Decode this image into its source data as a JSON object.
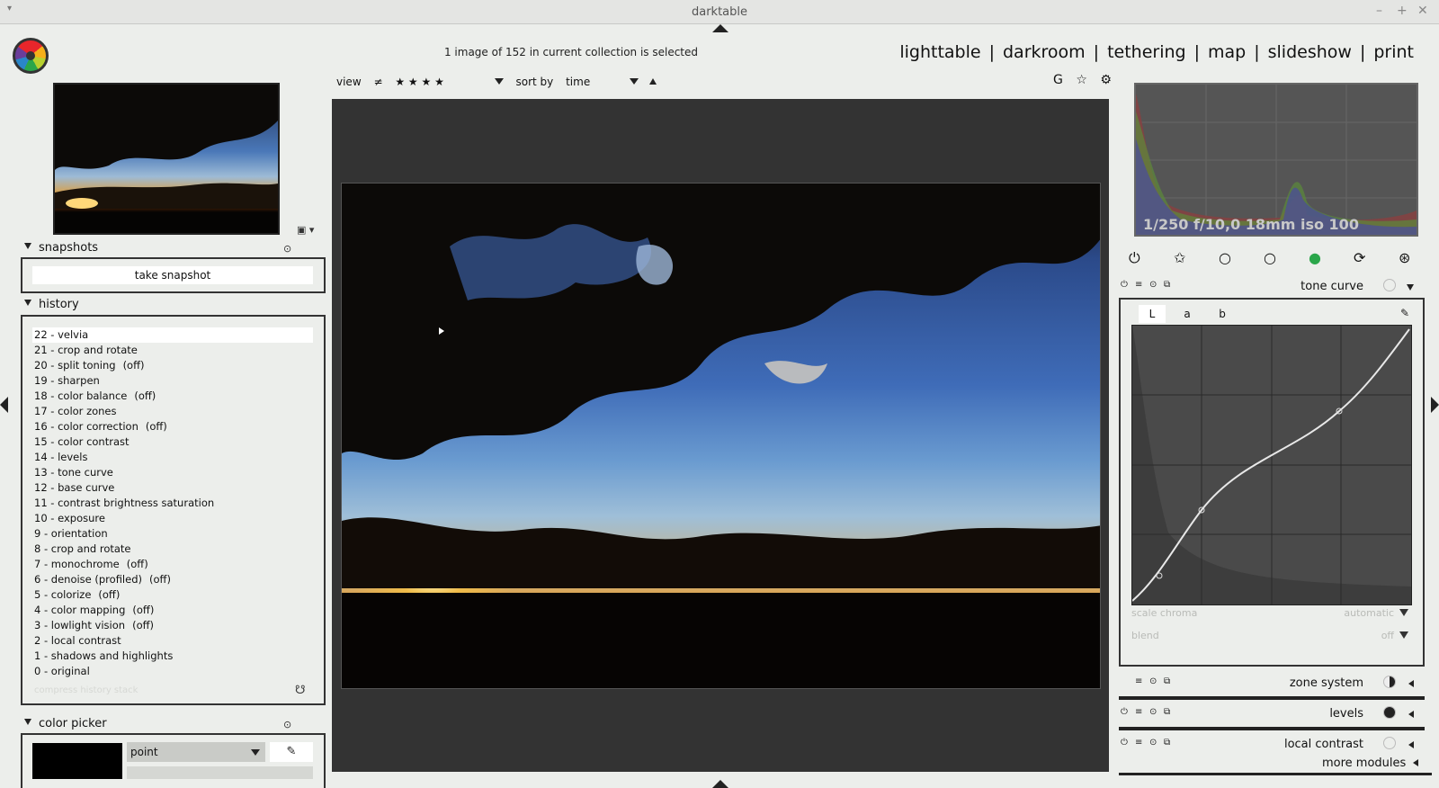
{
  "window": {
    "title": "darktable",
    "menu_glyph": "▾",
    "minimize": "–",
    "maximize": "+",
    "close": "✕"
  },
  "header": {
    "status": "1 image of 152 in current collection is selected",
    "views": [
      "lighttable",
      "darkroom",
      "tethering",
      "map",
      "slideshow",
      "print"
    ],
    "separator": "|"
  },
  "filterbar": {
    "view_label": "view",
    "rating_op": "≠",
    "stars": "★ ★ ★ ★",
    "sort_label": "sort by",
    "sort_value": "time",
    "icons": {
      "grouping": "G",
      "overlays": "☆",
      "preferences": "⚙"
    }
  },
  "left": {
    "thumb_ctl": "▣ ▾",
    "snapshots": {
      "title": "snapshots",
      "button": "take snapshot",
      "header_icon": "⊙"
    },
    "history": {
      "title": "history",
      "items": [
        {
          "label": "22 - velvia",
          "state": "",
          "selected": true
        },
        {
          "label": "21 - crop and rotate",
          "state": ""
        },
        {
          "label": "20 - split toning",
          "state": "(off)"
        },
        {
          "label": "19 - sharpen",
          "state": ""
        },
        {
          "label": "18 - color balance",
          "state": "(off)"
        },
        {
          "label": "17 - color zones",
          "state": ""
        },
        {
          "label": "16 - color correction",
          "state": "(off)"
        },
        {
          "label": "15 - color contrast",
          "state": ""
        },
        {
          "label": "14 - levels",
          "state": ""
        },
        {
          "label": "13 - tone curve",
          "state": ""
        },
        {
          "label": "12 - base curve",
          "state": ""
        },
        {
          "label": "11 - contrast brightness saturation",
          "state": ""
        },
        {
          "label": "10 - exposure",
          "state": ""
        },
        {
          "label": "9 - orientation",
          "state": ""
        },
        {
          "label": "8 - crop and rotate",
          "state": ""
        },
        {
          "label": "7 - monochrome",
          "state": "(off)"
        },
        {
          "label": "6 - denoise (profiled)",
          "state": "(off)"
        },
        {
          "label": "5 - colorize",
          "state": "(off)"
        },
        {
          "label": "4 - color mapping",
          "state": "(off)"
        },
        {
          "label": "3 - lowlight vision",
          "state": "(off)"
        },
        {
          "label": "2 - local contrast",
          "state": ""
        },
        {
          "label": "1 - shadows and highlights",
          "state": ""
        },
        {
          "label": "0 - original",
          "state": ""
        }
      ],
      "compress": "compress history stack",
      "style_icon": "☋"
    },
    "color_picker": {
      "title": "color picker",
      "mode": "point",
      "picker_icon": "✎",
      "header_icon": "⊙"
    }
  },
  "right": {
    "histogram_info": "1/250 f/10,0 18mm iso 100",
    "group_tabs": [
      "⏻",
      "✩",
      "○",
      "○",
      "●",
      "⟳",
      "⊛"
    ],
    "tone_curve": {
      "name": "tone curve",
      "channels": [
        "L",
        "a",
        "b"
      ],
      "picker_icon": "✎",
      "scale_chroma_label": "scale chroma",
      "scale_chroma_value": "automatic",
      "blend_label": "blend",
      "blend_value": "off"
    },
    "modules": [
      {
        "name": "zone system"
      },
      {
        "name": "levels"
      },
      {
        "name": "local contrast"
      }
    ],
    "module_icons": {
      "power": "⏻",
      "presets": "≡",
      "reset": "⊙",
      "multi": "⧉"
    },
    "more_modules": "more modules"
  },
  "colors": {
    "background": "#eceeeb",
    "center": "#333333",
    "accent_green": "#2aa64a"
  }
}
